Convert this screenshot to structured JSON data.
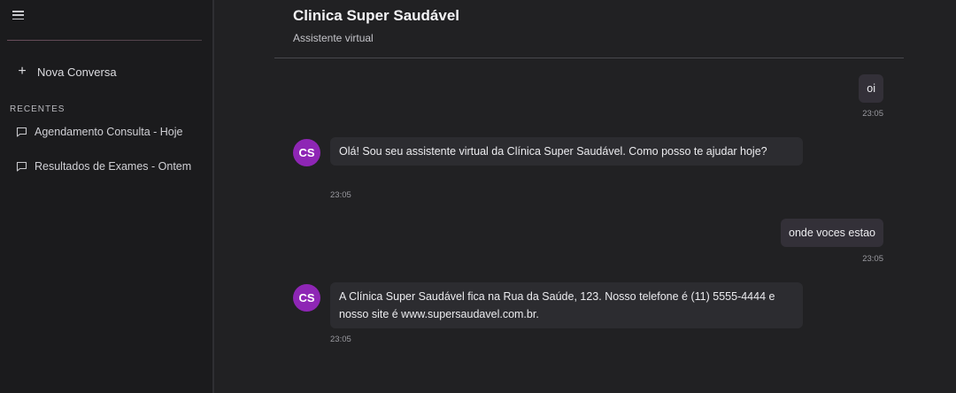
{
  "sidebar": {
    "new_chat_label": "Nova Conversa",
    "recents_title": "RECENTES",
    "items": [
      {
        "label": "Agendamento Consulta - Hoje"
      },
      {
        "label": "Resultados de Exames - Ontem"
      }
    ]
  },
  "header": {
    "title": "Clinica Super Saudável",
    "subtitle": "Assistente virtual"
  },
  "messages": [
    {
      "role": "user",
      "text": "oi",
      "time": "23:05"
    },
    {
      "role": "bot",
      "avatar": "CS",
      "text": "Olá! Sou seu assistente virtual da Clínica Super Saudável. Como posso te ajudar hoje?",
      "time": "23:05"
    },
    {
      "role": "user",
      "text": "onde voces estao",
      "time": "23:05"
    },
    {
      "role": "bot",
      "avatar": "CS",
      "text": "A Clínica Super Saudável fica na Rua da Saúde, 123. Nosso telefone é (11) 5555-4444 e nosso site é www.supersaudavel.com.br.",
      "time": "23:05"
    }
  ],
  "colors": {
    "avatar": "#8e26b5",
    "background": "#212123",
    "sidebar": "#1b1b1d"
  }
}
